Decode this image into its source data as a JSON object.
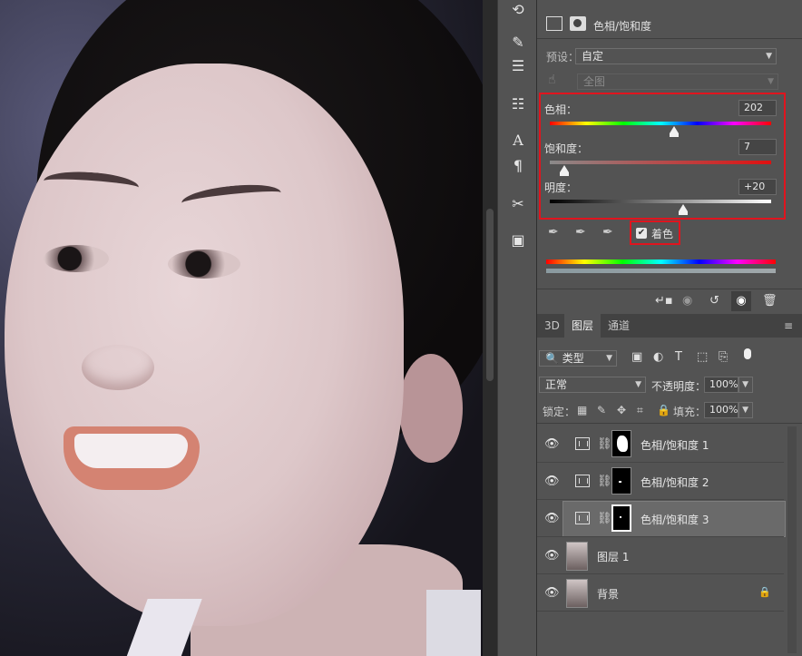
{
  "properties": {
    "title": "色相/饱和度",
    "preset_label": "预设：",
    "preset_value": "自定",
    "channel_value": "全图",
    "hue_label": "色相：",
    "hue_value": "202",
    "sat_label": "饱和度：",
    "sat_value": "7",
    "light_label": "明度：",
    "light_value": "+20",
    "colorize_label": "着色",
    "colorize_checked": true
  },
  "layers_panel": {
    "tabs": [
      "3D",
      "图层",
      "通道"
    ],
    "filter_value": "类型",
    "blend_mode": "正常",
    "opacity_label": "不透明度：",
    "opacity_value": "100%",
    "lock_label": "锁定：",
    "fill_label": "填充：",
    "fill_value": "100%",
    "layers": [
      {
        "name": "色相/饱和度 1",
        "type": "adjustment"
      },
      {
        "name": "色相/饱和度 2",
        "type": "adjustment"
      },
      {
        "name": "色相/饱和度 3",
        "type": "adjustment",
        "selected": true
      },
      {
        "name": "图层 1",
        "type": "pixel"
      },
      {
        "name": "背景",
        "type": "background",
        "locked": true
      }
    ]
  },
  "colors": {
    "highlight": "#e0141e",
    "panel": "#535353",
    "selected_row": "#6a6a6a"
  }
}
